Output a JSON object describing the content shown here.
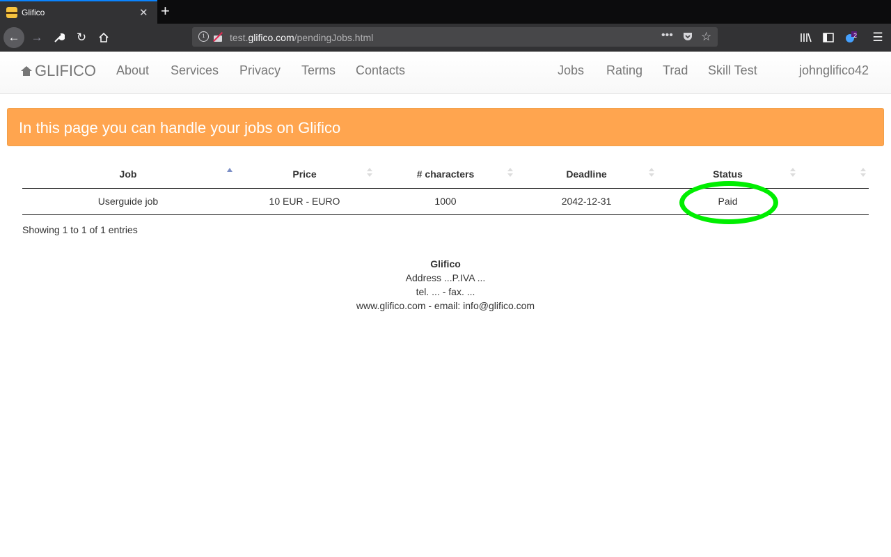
{
  "browser": {
    "tab_title": "Glifico",
    "url_prefix": "test.",
    "url_domain": "glifico.com",
    "url_path": "/pendingJobs.html",
    "notification_count": "2"
  },
  "site": {
    "brand": "GLIFICO",
    "nav_left": [
      "About",
      "Services",
      "Privacy",
      "Terms",
      "Contacts"
    ],
    "nav_right": [
      "Jobs",
      "Rating",
      "Trad",
      "Skill Test"
    ],
    "username": "johnglifico42"
  },
  "alert": {
    "text": "In this page you can handle your jobs on Glifico",
    "color": "#ffa54f"
  },
  "table": {
    "headers": [
      "Job",
      "Price",
      "# characters",
      "Deadline",
      "Status",
      ""
    ],
    "rows": [
      {
        "job": "Userguide job",
        "price": "10 EUR - EURO",
        "characters": "1000",
        "deadline": "2042-12-31",
        "status": "Paid",
        "action": ""
      }
    ],
    "info": "Showing 1 to 1 of 1 entries"
  },
  "footer": {
    "name": "Glifico",
    "address": "Address ...P.IVA ...",
    "phone": "tel. ... - fax. ...",
    "contact": "www.glifico.com - email: info@glifico.com"
  },
  "highlight_color": "#00ee00"
}
